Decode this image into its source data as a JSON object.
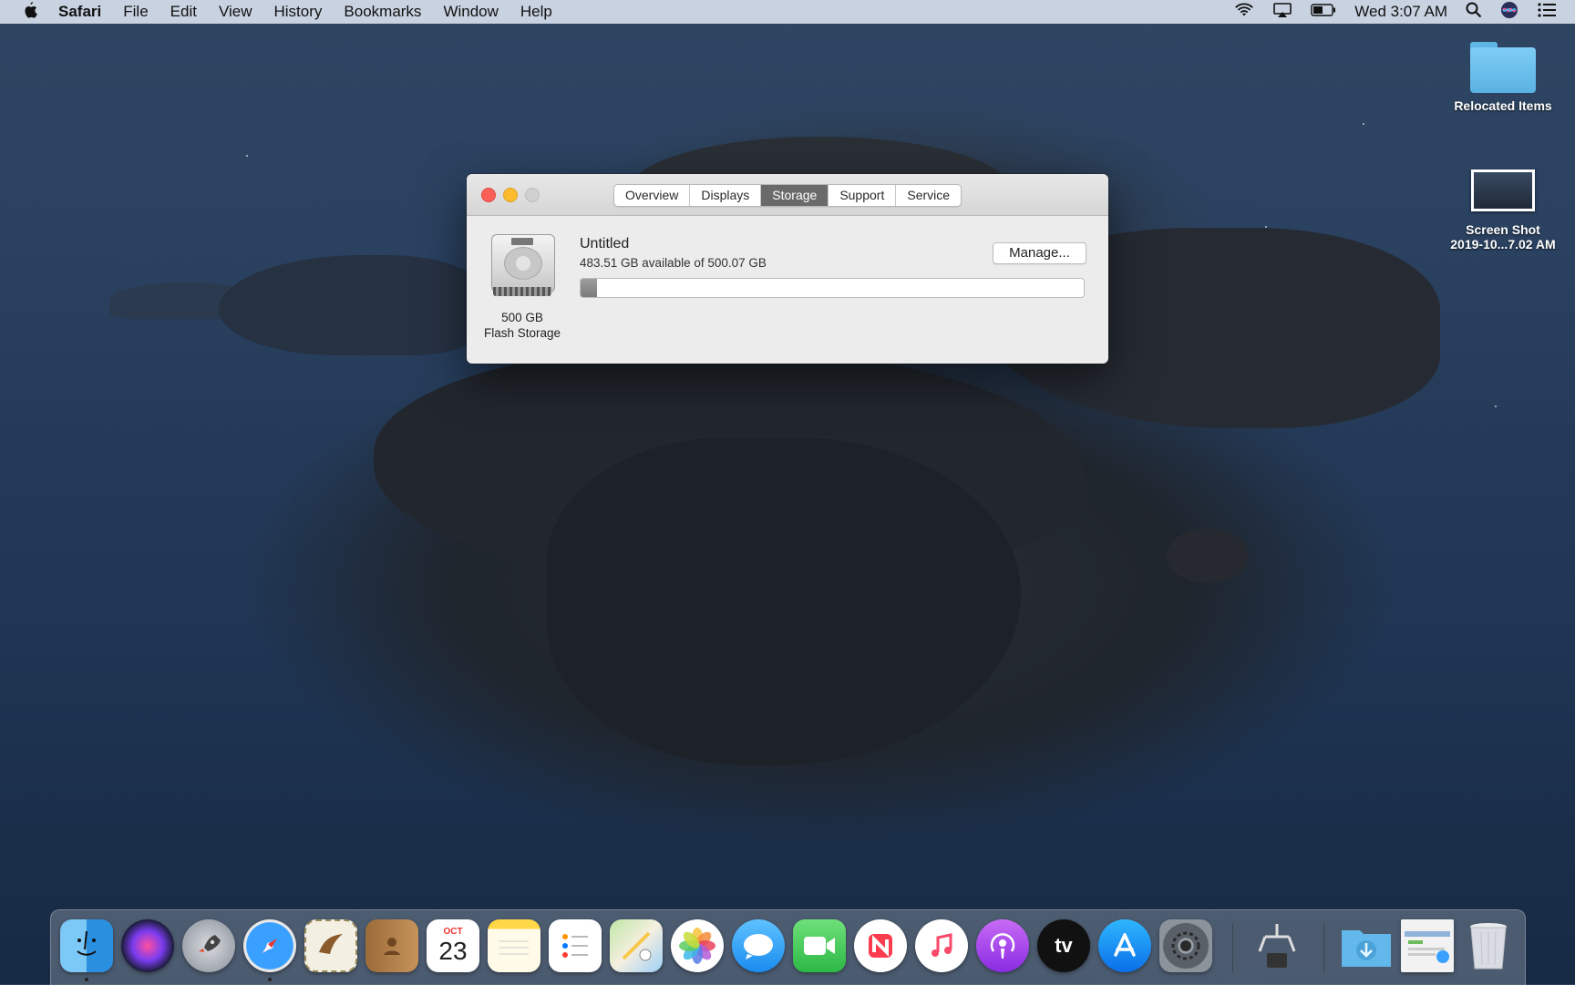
{
  "menubar": {
    "apple": "",
    "app": "Safari",
    "items": [
      "File",
      "Edit",
      "View",
      "History",
      "Bookmarks",
      "Window",
      "Help"
    ],
    "clock": "Wed 3:07 AM"
  },
  "desktop": {
    "folder_label": "Relocated Items",
    "screenshot_label_line1": "Screen Shot",
    "screenshot_label_line2": "2019-10...7.02 AM"
  },
  "window": {
    "tabs": [
      "Overview",
      "Displays",
      "Storage",
      "Support",
      "Service"
    ],
    "active_tab": "Storage",
    "drive_caption_line1": "500 GB",
    "drive_caption_line2": "Flash Storage",
    "volume_name": "Untitled",
    "volume_available": "483.51 GB available of 500.07 GB",
    "used_fraction": 0.033,
    "manage_label": "Manage..."
  },
  "dock": {
    "items": [
      "Finder",
      "Siri",
      "Launchpad",
      "Safari",
      "Mail",
      "Contacts",
      "Calendar",
      "Notes",
      "Reminders",
      "Maps",
      "Photos",
      "Messages",
      "FaceTime",
      "News",
      "Music",
      "Podcasts",
      "TV",
      "App Store",
      "System Preferences",
      "Directory Utility",
      "Downloads",
      "Screen Shot",
      "Trash"
    ],
    "calendar_month": "OCT",
    "calendar_day": "23",
    "tv_label": "tv"
  }
}
